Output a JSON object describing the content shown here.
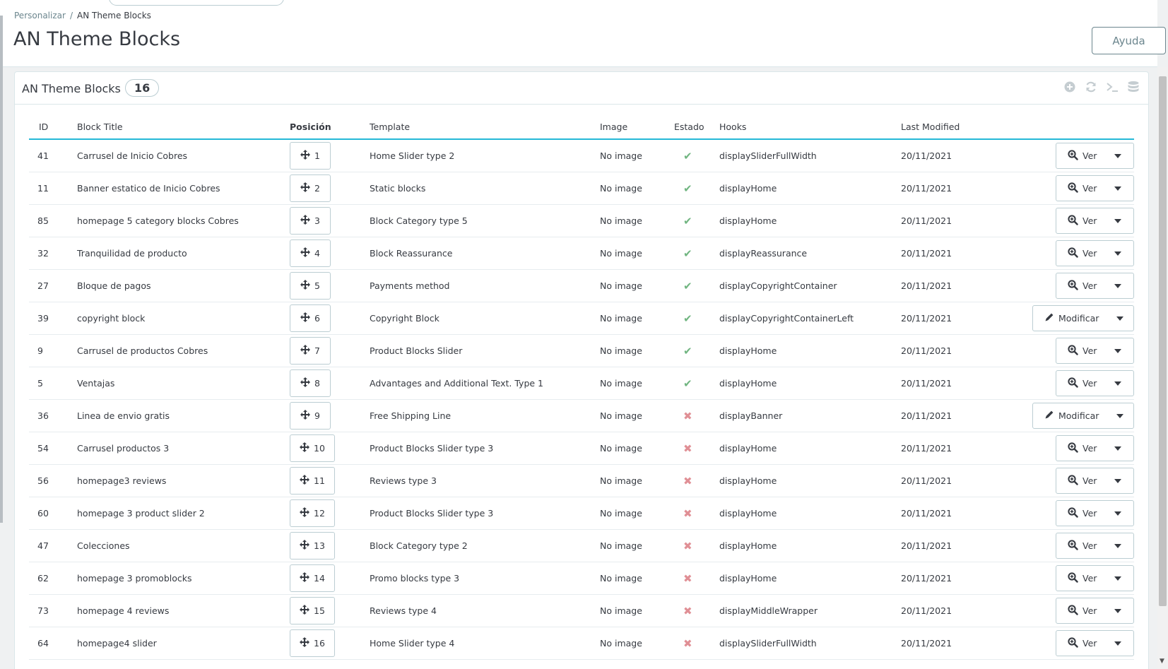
{
  "breadcrumb": {
    "parent": "Personalizar",
    "separator": "/",
    "current": "AN Theme Blocks"
  },
  "page": {
    "title": "AN Theme Blocks",
    "help_label": "Ayuda"
  },
  "panel": {
    "title": "AN Theme Blocks",
    "count": "16"
  },
  "toolbar_icons": [
    "add-icon",
    "refresh-icon",
    "terminal-icon",
    "database-icon"
  ],
  "columns": {
    "id": "ID",
    "title": "Block Title",
    "position": "Posición",
    "template": "Template",
    "image": "Image",
    "status": "Estado",
    "hooks": "Hooks",
    "modified": "Last Modified"
  },
  "colors": {
    "accent": "#25b9d7",
    "ok": "#70b580",
    "error": "#e08f95"
  },
  "rows": [
    {
      "id": "41",
      "title": "Carrusel de Inicio Cobres",
      "position": "1",
      "template": "Home Slider type 2",
      "image": "No image",
      "active": true,
      "hook": "displaySliderFullWidth",
      "modified": "20/11/2021",
      "action": "Ver",
      "action_icon": "zoom-icon"
    },
    {
      "id": "11",
      "title": "Banner estatico de Inicio Cobres",
      "position": "2",
      "template": "Static blocks",
      "image": "No image",
      "active": true,
      "hook": "displayHome",
      "modified": "20/11/2021",
      "action": "Ver",
      "action_icon": "zoom-icon"
    },
    {
      "id": "85",
      "title": "homepage 5 category blocks Cobres",
      "position": "3",
      "template": "Block Category type 5",
      "image": "No image",
      "active": true,
      "hook": "displayHome",
      "modified": "20/11/2021",
      "action": "Ver",
      "action_icon": "zoom-icon"
    },
    {
      "id": "32",
      "title": "Tranquilidad de producto",
      "position": "4",
      "template": "Block Reassurance",
      "image": "No image",
      "active": true,
      "hook": "displayReassurance",
      "modified": "20/11/2021",
      "action": "Ver",
      "action_icon": "zoom-icon"
    },
    {
      "id": "27",
      "title": "Bloque de pagos",
      "position": "5",
      "template": "Payments method",
      "image": "No image",
      "active": true,
      "hook": "displayCopyrightContainer",
      "modified": "20/11/2021",
      "action": "Ver",
      "action_icon": "zoom-icon"
    },
    {
      "id": "39",
      "title": "copyright block",
      "position": "6",
      "template": "Copyright Block",
      "image": "No image",
      "active": true,
      "hook": "displayCopyrightContainerLeft",
      "modified": "20/11/2021",
      "action": "Modificar",
      "action_icon": "pencil-icon"
    },
    {
      "id": "9",
      "title": "Carrusel de productos Cobres",
      "position": "7",
      "template": "Product Blocks Slider",
      "image": "No image",
      "active": true,
      "hook": "displayHome",
      "modified": "20/11/2021",
      "action": "Ver",
      "action_icon": "zoom-icon"
    },
    {
      "id": "5",
      "title": "Ventajas",
      "position": "8",
      "template": "Advantages and Additional Text. Type 1",
      "image": "No image",
      "active": true,
      "hook": "displayHome",
      "modified": "20/11/2021",
      "action": "Ver",
      "action_icon": "zoom-icon"
    },
    {
      "id": "36",
      "title": "Linea de envio gratis",
      "position": "9",
      "template": "Free Shipping Line",
      "image": "No image",
      "active": false,
      "hook": "displayBanner",
      "modified": "20/11/2021",
      "action": "Modificar",
      "action_icon": "pencil-icon"
    },
    {
      "id": "54",
      "title": "Carrusel productos 3",
      "position": "10",
      "template": "Product Blocks Slider type 3",
      "image": "No image",
      "active": false,
      "hook": "displayHome",
      "modified": "20/11/2021",
      "action": "Ver",
      "action_icon": "zoom-icon"
    },
    {
      "id": "56",
      "title": "homepage3 reviews",
      "position": "11",
      "template": "Reviews type 3",
      "image": "No image",
      "active": false,
      "hook": "displayHome",
      "modified": "20/11/2021",
      "action": "Ver",
      "action_icon": "zoom-icon"
    },
    {
      "id": "60",
      "title": "homepage 3 product slider 2",
      "position": "12",
      "template": "Product Blocks Slider type 3",
      "image": "No image",
      "active": false,
      "hook": "displayHome",
      "modified": "20/11/2021",
      "action": "Ver",
      "action_icon": "zoom-icon"
    },
    {
      "id": "47",
      "title": "Colecciones",
      "position": "13",
      "template": "Block Category type 2",
      "image": "No image",
      "active": false,
      "hook": "displayHome",
      "modified": "20/11/2021",
      "action": "Ver",
      "action_icon": "zoom-icon"
    },
    {
      "id": "62",
      "title": "homepage 3 promoblocks",
      "position": "14",
      "template": "Promo blocks type 3",
      "image": "No image",
      "active": false,
      "hook": "displayHome",
      "modified": "20/11/2021",
      "action": "Ver",
      "action_icon": "zoom-icon"
    },
    {
      "id": "73",
      "title": "homepage 4 reviews",
      "position": "15",
      "template": "Reviews type 4",
      "image": "No image",
      "active": false,
      "hook": "displayMiddleWrapper",
      "modified": "20/11/2021",
      "action": "Ver",
      "action_icon": "zoom-icon"
    },
    {
      "id": "64",
      "title": "homepage4 slider",
      "position": "16",
      "template": "Home Slider type 4",
      "image": "No image",
      "active": false,
      "hook": "displaySliderFullWidth",
      "modified": "20/11/2021",
      "action": "Ver",
      "action_icon": "zoom-icon"
    }
  ]
}
